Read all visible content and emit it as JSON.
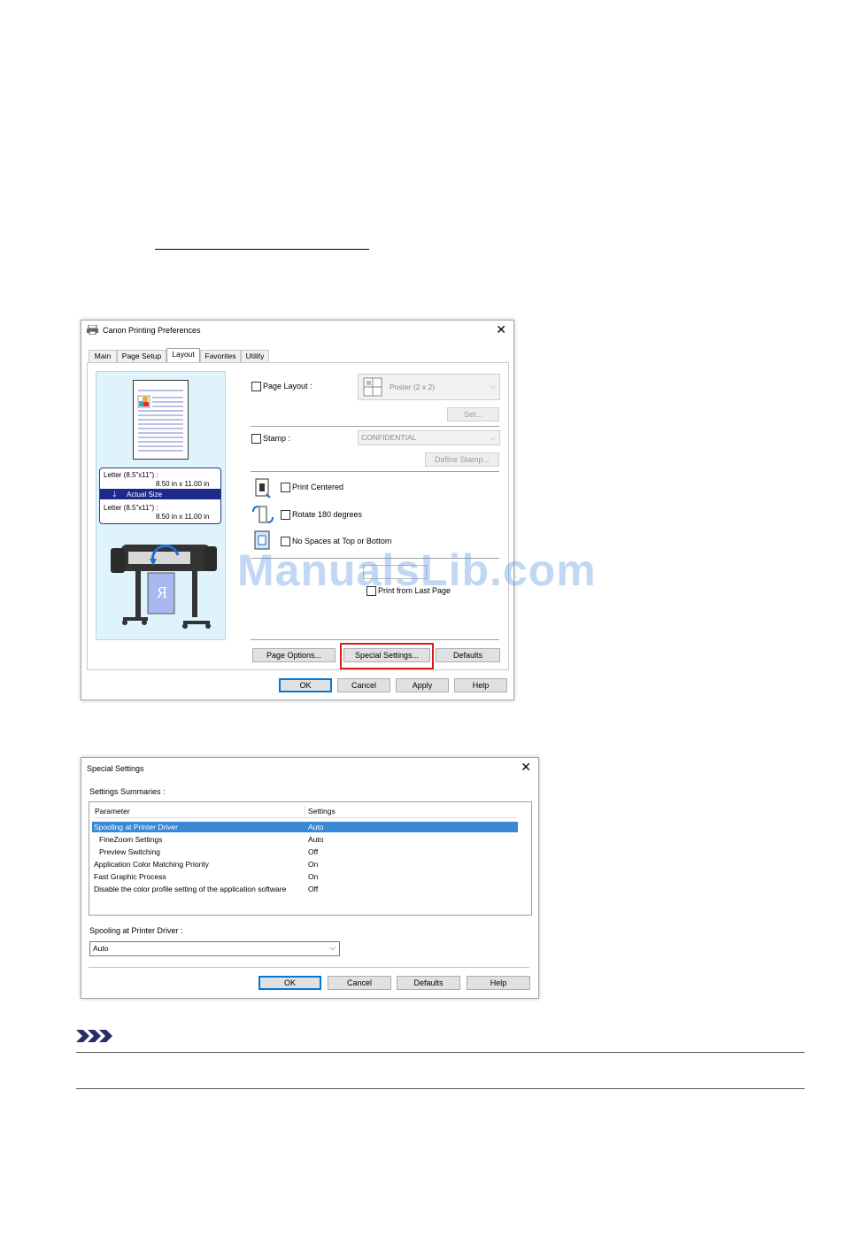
{
  "prefs_dialog": {
    "title": "Canon          Printing Preferences",
    "tabs": [
      "Main",
      "Page Setup",
      "Layout",
      "Favorites",
      "Utility"
    ],
    "preview": {
      "letter_label": "Letter (8.5\"x11\") :",
      "letter_size": "8.50 in x 11.00 in",
      "actual_size": "Actual Size",
      "letter_label_2": "Letter (8.5\"x11\") :",
      "letter_size_2": "8.50 in x 11.00 in"
    },
    "page_layout_label": "Page Layout :",
    "page_layout_value": "Poster (2 x 2)",
    "set_button": "Set...",
    "stamp_label": "Stamp :",
    "stamp_value": "CONFIDENTIAL",
    "define_stamp_button": "Define Stamp...",
    "print_centered": "Print Centered",
    "rotate_180": "Rotate 180 degrees",
    "no_spaces": "No Spaces at Top or Bottom",
    "print_from_last": "Print from Last Page",
    "page_options_button": "Page Options...",
    "special_settings_button": "Special Settings...",
    "defaults_button": "Defaults",
    "ok_button": "OK",
    "cancel_button": "Cancel",
    "apply_button": "Apply",
    "help_button": "Help"
  },
  "special_dialog": {
    "title": "Special Settings",
    "summaries_label": "Settings Summaries :",
    "col_parameter": "Parameter",
    "col_settings": "Settings",
    "rows": [
      {
        "param": "Spooling at Printer Driver",
        "value": "Auto"
      },
      {
        "param": "  FineZoom Settings",
        "value": "Auto"
      },
      {
        "param": "  Preview Switching",
        "value": "Off"
      },
      {
        "param": "Application Color Matching Priority",
        "value": "On"
      },
      {
        "param": "Fast Graphic Process",
        "value": "On"
      },
      {
        "param": "Disable the color profile setting of the application software",
        "value": "Off"
      }
    ],
    "spooling_label": "Spooling at Printer Driver :",
    "spooling_value": "Auto",
    "ok_button": "OK",
    "cancel_button": "Cancel",
    "defaults_button": "Defaults",
    "help_button": "Help"
  },
  "watermark": "ManualsLib.com",
  "colors": {
    "highlight_red": "#d62020",
    "selection_blue": "#3a87d6",
    "info_dark_blue": "#1c2a8a"
  }
}
